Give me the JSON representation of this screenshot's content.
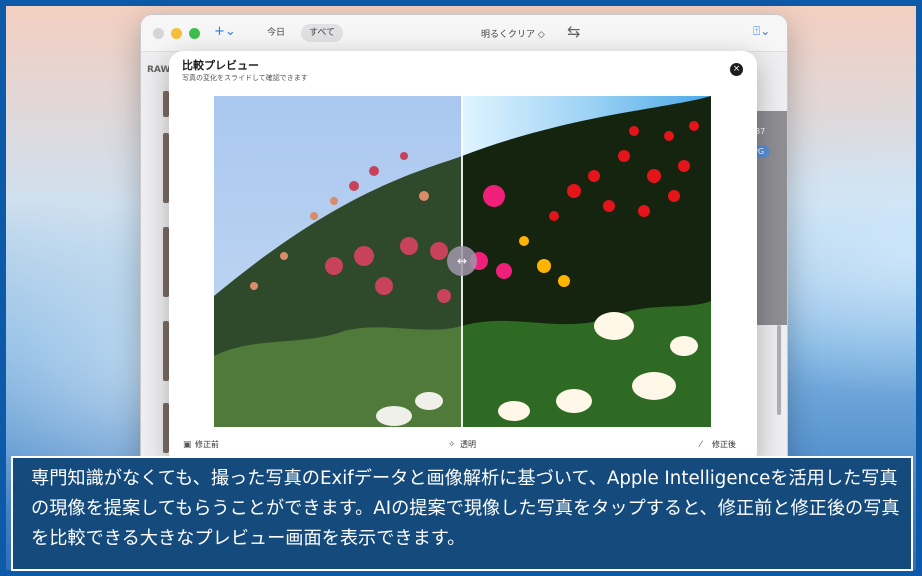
{
  "window": {
    "toolbar": {
      "add_icon": "plus-icon",
      "add_label": "+⌄",
      "tab_today": "今日",
      "tab_all": "すべて",
      "preset_select": "明るくクリア ◇",
      "swap_icon": "⇆",
      "share_icon": "share-icon",
      "share_label": "⍐⌄"
    },
    "sidebar": {
      "section_label": "RAW"
    },
    "right_panel": {
      "count_text": "87",
      "format_badge": "PG"
    }
  },
  "sheet": {
    "title": "比較プレビュー",
    "subtitle": "写真の変化をスライドして確認できます",
    "close_glyph": "×",
    "handle_glyph": "↔",
    "labels": {
      "before": "修正前",
      "transparent": "透明",
      "after": "修正後"
    },
    "icons": {
      "before": "image-icon",
      "transparent": "sparkle-icon",
      "after": "magic-wand-icon"
    }
  },
  "caption": {
    "text": "専門知識がなくても、撮った写真のExifデータと画像解析に基づいて、Apple Intelligenceを活用した写真の現像を提案してもらうことができます。AIの提案で現像した写真をタップすると、修正前と修正後の写真を比較できる大きなプレビュー画面を表示できます。"
  },
  "colors": {
    "frame_border": "#0d5aa8",
    "caption_bg": "#154a7c",
    "accent": "#2c7be5"
  }
}
